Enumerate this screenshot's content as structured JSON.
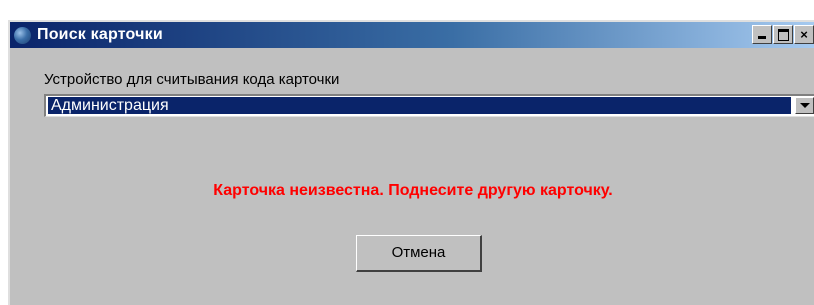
{
  "window": {
    "title": "Поиск карточки",
    "buttons": {
      "minimize": "_",
      "maximize": "□",
      "close": "×"
    },
    "title_gradient": [
      "#0a246a",
      "#3a6ea5",
      "#a6caf0"
    ]
  },
  "reader": {
    "label": "Устройство для считывания кода карточки",
    "selected": "Администрация"
  },
  "status": {
    "message": "Карточка неизвестна. Поднесите другую карточку.",
    "color": "#ff0000"
  },
  "actions": {
    "cancel_label": "Отмена"
  },
  "icons": [
    "app-icon",
    "minimize-icon",
    "maximize-icon",
    "close-icon",
    "dropdown-arrow-icon"
  ]
}
